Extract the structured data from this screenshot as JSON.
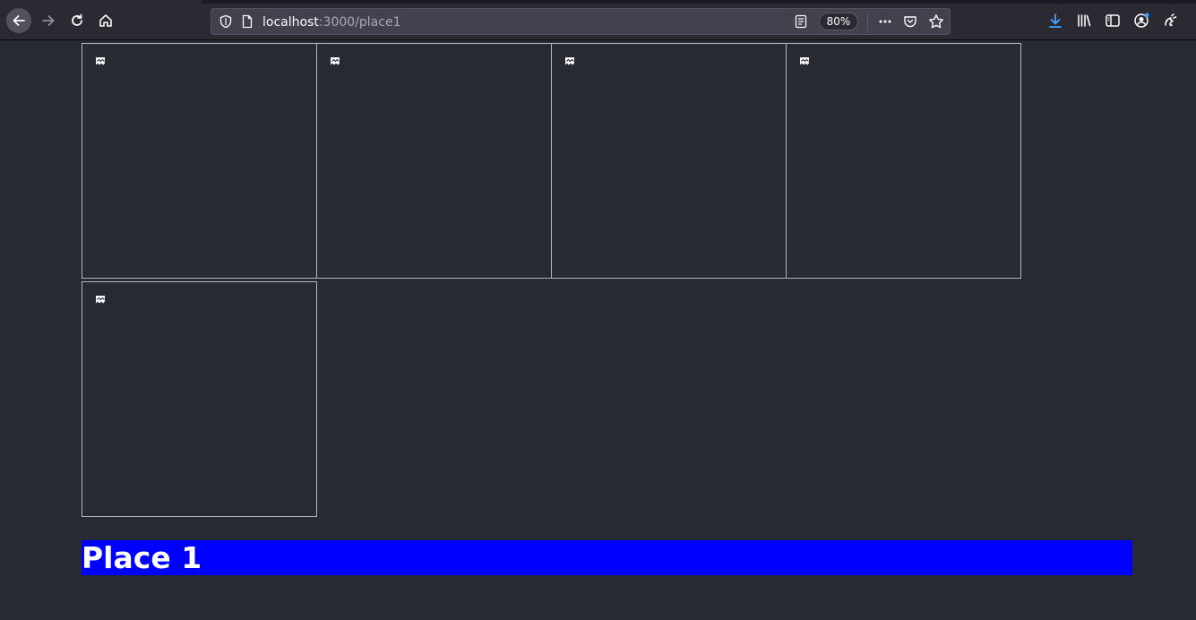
{
  "browser": {
    "url_host": "localhost",
    "url_path": ":3000/place1",
    "zoom": "80%"
  },
  "gallery": {
    "images": [
      {
        "alt": "",
        "state": "broken"
      },
      {
        "alt": "",
        "state": "broken"
      },
      {
        "alt": "",
        "state": "broken"
      },
      {
        "alt": "",
        "state": "broken"
      },
      {
        "alt": "",
        "state": "broken"
      }
    ]
  },
  "page": {
    "title": "Place 1"
  },
  "colors": {
    "background": "#282a33",
    "title_bar": "#0000ff",
    "title_text": "#ffffff",
    "tile_border": "#b5b5b5",
    "download_accent": "#45a1ff"
  }
}
